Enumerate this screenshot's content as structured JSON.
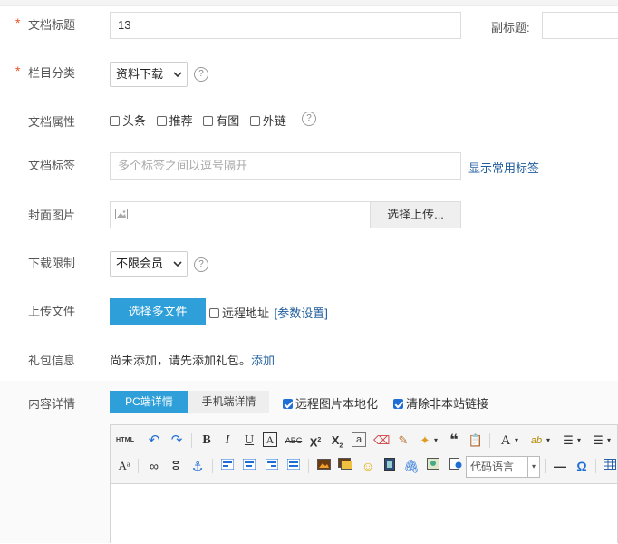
{
  "form": {
    "title_label": "文档标题",
    "title_value": "13",
    "subtitle_label": "副标题:",
    "category_label": "栏目分类",
    "category_value": "资料下载",
    "attributes_label": "文档属性",
    "attributes": [
      "头条",
      "推荐",
      "有图",
      "外链"
    ],
    "tags_label": "文档标签",
    "tags_placeholder": "多个标签之间以逗号隔开",
    "tags_link": "显示常用标签",
    "cover_label": "封面图片",
    "cover_button": "选择上传...",
    "download_limit_label": "下载限制",
    "download_limit_value": "不限会员",
    "upload_label": "上传文件",
    "upload_button": "选择多文件",
    "remote_addr_label": "远程地址",
    "param_settings": "[参数设置]",
    "gift_label": "礼包信息",
    "gift_text": "尚未添加，请先添加礼包。",
    "gift_add": "添加",
    "content_label": "内容详情",
    "tab_pc": "PC端详情",
    "tab_mobile": "手机端详情",
    "remote_img_label": "远程图片本地化",
    "clear_links_label": "清除非本站链接",
    "code_lang_placeholder": "代码语言",
    "required_mark": "*",
    "help_mark": "?"
  },
  "editor": {
    "row1_icons": [
      "html-icon",
      "undo-icon",
      "redo-icon",
      "bold-icon",
      "italic-icon",
      "underline-icon",
      "font-border-icon",
      "strikethrough-icon",
      "superscript-icon",
      "subscript-icon",
      "format-match-icon",
      "eraser-icon",
      "brush-icon",
      "magic-icon",
      "quote-icon",
      "paste-icon",
      "font-color-icon",
      "highlight-icon",
      "ordered-list-icon",
      "unordered-list-icon"
    ],
    "row2_icons": [
      "font-size-icon",
      "link-icon",
      "unlink-icon",
      "anchor-icon",
      "align-left-icon",
      "align-center-icon",
      "align-right-icon",
      "align-justify-icon",
      "image-icon",
      "multi-image-icon",
      "emoji-icon",
      "video-icon",
      "attachment-icon",
      "map-icon",
      "code-icon",
      "horizontal-rule-icon",
      "special-char-icon",
      "table-icon"
    ],
    "html_text": "HTML"
  }
}
